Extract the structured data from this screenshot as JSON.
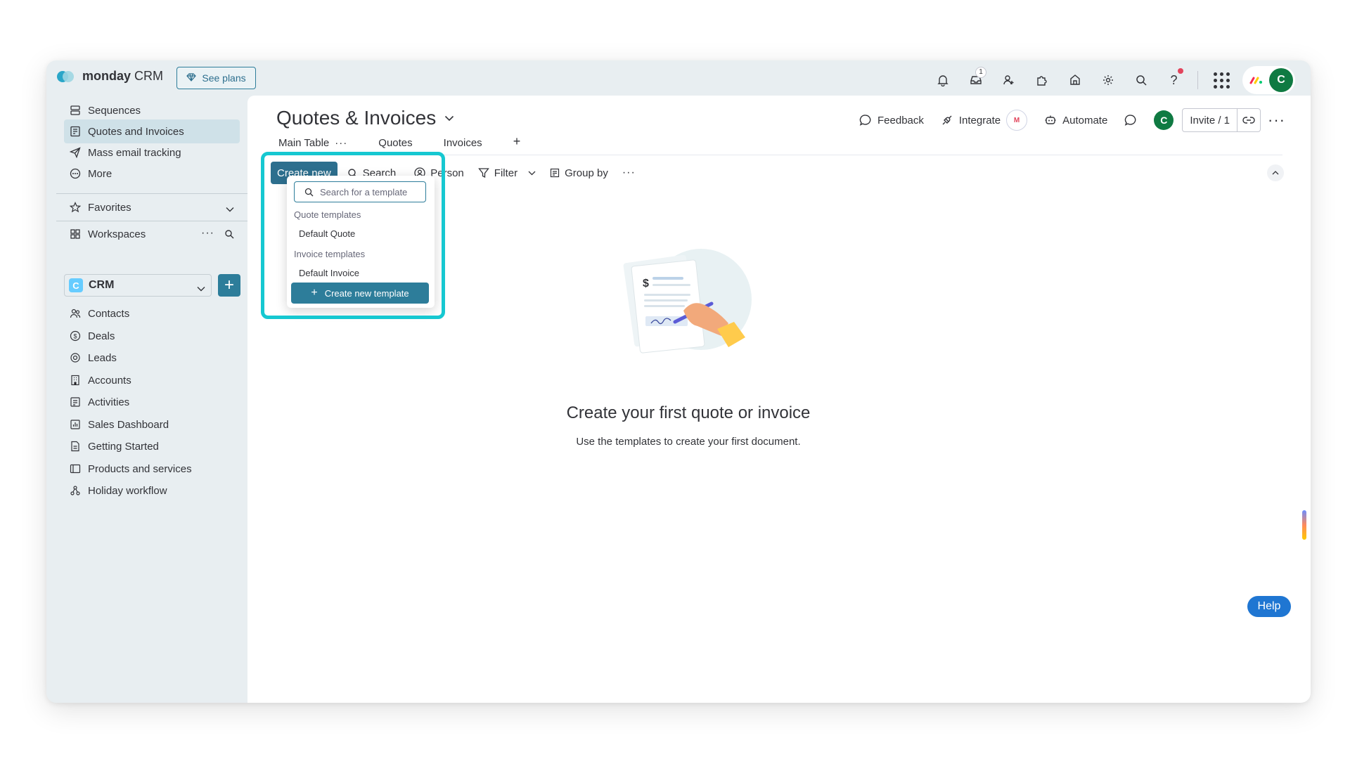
{
  "app": {
    "brand_bold": "monday",
    "brand_rest": "CRM",
    "see_plans": "See plans",
    "inbox_badge": "1",
    "avatar_initial": "C"
  },
  "sidebar": {
    "items_top": [
      {
        "label": "Sequences",
        "icon": "sequences-icon"
      },
      {
        "label": "Quotes and Invoices",
        "icon": "quotes-icon",
        "active": true
      },
      {
        "label": "Mass email tracking",
        "icon": "send-icon"
      },
      {
        "label": "More",
        "icon": "more-icon"
      }
    ],
    "favorites": "Favorites",
    "workspaces": "Workspaces",
    "workspace_name": "CRM",
    "workspace_letter": "C",
    "boards": [
      {
        "label": "Contacts",
        "icon": "contacts-icon"
      },
      {
        "label": "Deals",
        "icon": "deals-icon"
      },
      {
        "label": "Leads",
        "icon": "leads-icon"
      },
      {
        "label": "Accounts",
        "icon": "accounts-icon"
      },
      {
        "label": "Activities",
        "icon": "activities-icon"
      },
      {
        "label": "Sales Dashboard",
        "icon": "dashboard-icon"
      },
      {
        "label": "Getting Started",
        "icon": "doc-icon"
      },
      {
        "label": "Products and services",
        "icon": "board-icon"
      },
      {
        "label": "Holiday workflow",
        "icon": "workflow-icon"
      }
    ]
  },
  "header": {
    "title": "Quotes & Invoices",
    "feedback": "Feedback",
    "integrate": "Integrate",
    "automate": "Automate",
    "invite": "Invite / 1",
    "avatar_initial": "C"
  },
  "tabs": [
    {
      "label": "Main Table",
      "active": true
    },
    {
      "label": "Quotes"
    },
    {
      "label": "Invoices"
    }
  ],
  "toolbar": {
    "create_new": "Create new",
    "search": "Search",
    "person": "Person",
    "filter": "Filter",
    "group_by": "Group by"
  },
  "dropdown": {
    "search_placeholder": "Search for a template",
    "quote_header": "Quote templates",
    "quote_item": "Default Quote",
    "invoice_header": "Invoice templates",
    "invoice_item": "Default Invoice",
    "create_template": "Create new template"
  },
  "empty_state": {
    "title": "Create your first quote or invoice",
    "subtitle": "Use the templates to create your first document."
  },
  "help": "Help",
  "colors": {
    "accent": "#2d7d9a",
    "highlight": "#16c8d1",
    "help": "#1f76d2",
    "avatar": "#0f7a42"
  }
}
